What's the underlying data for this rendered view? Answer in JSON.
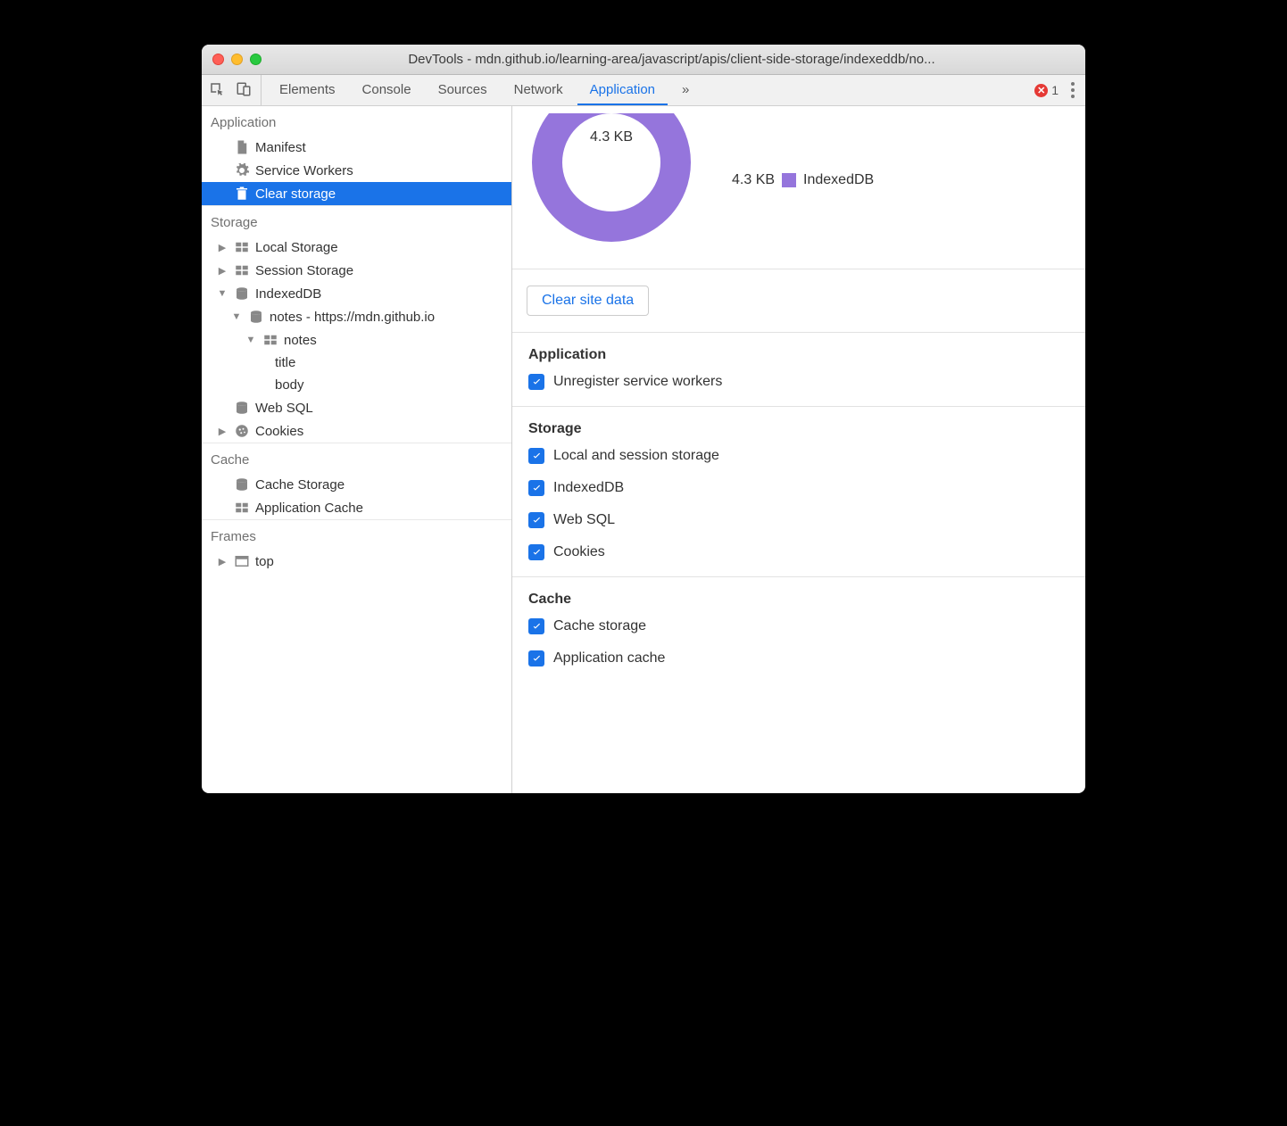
{
  "window_title": "DevTools - mdn.github.io/learning-area/javascript/apis/client-side-storage/indexeddb/no...",
  "toolbar": {
    "tabs": [
      "Elements",
      "Console",
      "Sources",
      "Network",
      "Application"
    ],
    "active_tab": "Application",
    "overflow": "»",
    "error_count": "1"
  },
  "sidebar": {
    "sections": {
      "application": {
        "title": "Application",
        "items": [
          "Manifest",
          "Service Workers",
          "Clear storage"
        ],
        "selected": "Clear storage"
      },
      "storage": {
        "title": "Storage",
        "local_storage": "Local Storage",
        "session_storage": "Session Storage",
        "indexeddb": "IndexedDB",
        "db_name": "notes - https://mdn.github.io",
        "store_name": "notes",
        "fields": [
          "title",
          "body"
        ],
        "web_sql": "Web SQL",
        "cookies": "Cookies"
      },
      "cache": {
        "title": "Cache",
        "cache_storage": "Cache Storage",
        "application_cache": "Application Cache"
      },
      "frames": {
        "title": "Frames",
        "top": "top"
      }
    }
  },
  "content": {
    "total_label": "4.3 KB",
    "legend_value": "4.3 KB",
    "legend_label": "IndexedDB",
    "clear_button": "Clear site data",
    "application_heading": "Application",
    "application_options": [
      "Unregister service workers"
    ],
    "storage_heading": "Storage",
    "storage_options": [
      "Local and session storage",
      "IndexedDB",
      "Web SQL",
      "Cookies"
    ],
    "cache_heading": "Cache",
    "cache_options": [
      "Cache storage",
      "Application cache"
    ]
  },
  "colors": {
    "accent": "#1a73e8",
    "donut": "#9575dc"
  }
}
